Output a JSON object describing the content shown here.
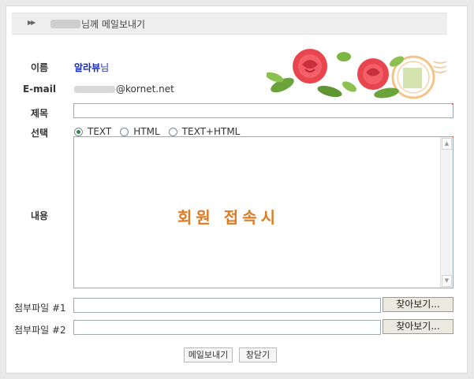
{
  "header": {
    "arrow_icon": "double-chevron-right-icon",
    "title_suffix": "님께 메일보내기"
  },
  "form": {
    "name_label": "이름",
    "name_value": "알라뷰",
    "name_suffix": "님",
    "email_label": "E-mail",
    "email_domain": "@kornet.net",
    "subject_label": "제목",
    "subject_value": "",
    "select_label": "선택",
    "format_options": [
      {
        "label": "TEXT",
        "selected": true
      },
      {
        "label": "HTML",
        "selected": false
      },
      {
        "label": "TEXT+HTML",
        "selected": false
      }
    ],
    "content_label": "내용",
    "content_notice": "회원 접속시",
    "attach1_label": "첨부파일 #1",
    "attach2_label": "첨부파일 #2",
    "browse_label": "찾아보기..."
  },
  "buttons": {
    "send": "메일보내기",
    "close": "창닫기"
  },
  "colors": {
    "accent_name": "#1a2bb3",
    "notice": "#e07a22",
    "field_border": "#9aaabb"
  }
}
